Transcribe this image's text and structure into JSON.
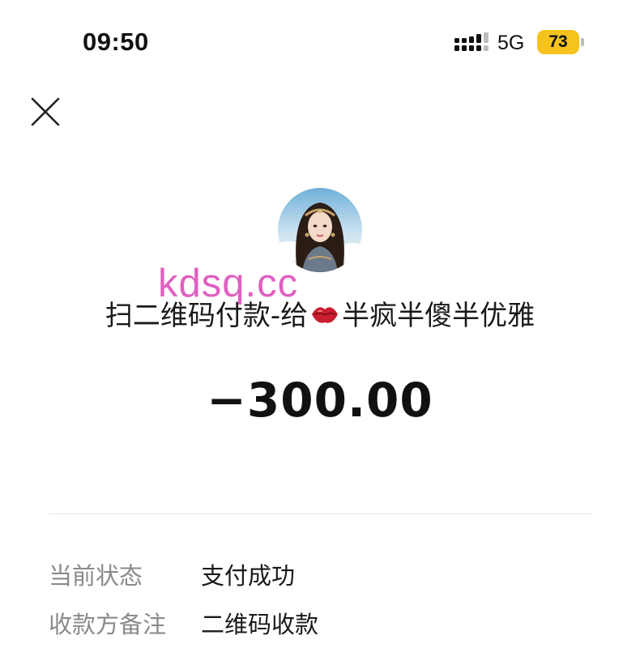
{
  "status_bar": {
    "time": "09:50",
    "network": "5G",
    "battery": "73",
    "battery_color": "#f6c21c"
  },
  "header": {
    "close_icon": "close-icon"
  },
  "payee": {
    "avatar_icon": "avatar",
    "title_prefix": "扫二维码付款-给",
    "title_emoji": "lips-emoji",
    "title_name": "半疯半傻半优雅"
  },
  "watermark": "kdsq.cc",
  "amount": "−300.00",
  "details": [
    {
      "label": "当前状态",
      "value": "支付成功"
    },
    {
      "label": "收款方备注",
      "value": "二维码收款"
    }
  ]
}
